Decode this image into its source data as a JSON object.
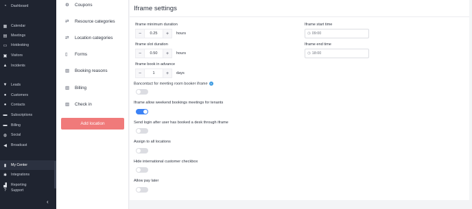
{
  "sidebar": {
    "items": [
      {
        "icon": "dashboard-icon",
        "glyph": "◔",
        "label": "Dashboard"
      },
      {
        "icon": "calendar-icon",
        "glyph": "▦",
        "label": "Calendar"
      },
      {
        "icon": "meetings-icon",
        "glyph": "▤",
        "label": "Meetings"
      },
      {
        "icon": "hotdesking-icon",
        "glyph": "▭",
        "label": "Hotdesking"
      },
      {
        "icon": "visitors-icon",
        "glyph": "▣",
        "label": "Visitors"
      },
      {
        "icon": "incidents-icon",
        "glyph": "▲",
        "label": "Incidents"
      },
      {
        "icon": "leads-icon",
        "glyph": "▼",
        "label": "Leads"
      },
      {
        "icon": "customers-icon",
        "glyph": "●",
        "label": "Customers"
      },
      {
        "icon": "contacts-icon",
        "glyph": "●",
        "label": "Contacts"
      },
      {
        "icon": "subscriptions-icon",
        "glyph": "▬",
        "label": "Subscriptions"
      },
      {
        "icon": "billing-icon",
        "glyph": "▬",
        "label": "Billing"
      },
      {
        "icon": "social-icon",
        "glyph": "◍",
        "label": "Social"
      },
      {
        "icon": "broadcast-icon",
        "glyph": "◀",
        "label": "Broadcast"
      },
      {
        "icon": "my-center-icon",
        "glyph": "▮",
        "label": "My Center"
      },
      {
        "icon": "integrations-icon",
        "glyph": "✱",
        "label": "Integrations"
      },
      {
        "icon": "reporting-icon",
        "glyph": "▟",
        "label": "Reporting"
      },
      {
        "icon": "support-icon",
        "glyph": "?",
        "label": "Support"
      }
    ],
    "collapse": "‹"
  },
  "menu": {
    "items": [
      {
        "icon": "coupons-icon",
        "glyph": "⚙",
        "label": "Coupons"
      },
      {
        "icon": "resource-categories-icon",
        "glyph": "⇄",
        "label": "Resource categories"
      },
      {
        "icon": "location-categories-icon",
        "glyph": "⇄",
        "label": "Location categories"
      },
      {
        "icon": "forms-icon",
        "glyph": "▯",
        "label": "Forms"
      },
      {
        "icon": "booking-reasons-icon",
        "glyph": "▥",
        "label": "Booking reasons"
      },
      {
        "icon": "billing-settings-icon",
        "glyph": "▥",
        "label": "Billing"
      },
      {
        "icon": "check-in-icon",
        "glyph": "▥",
        "label": "Check in"
      }
    ],
    "add_location": "Add location"
  },
  "iframe_settings": {
    "title": "Iframe settings",
    "min_duration": {
      "label": "Iframe minimum duration",
      "value": "0.25",
      "unit": "hours"
    },
    "slot_duration": {
      "label": "Iframe slot duration",
      "value": "0.50",
      "unit": "hours"
    },
    "book_in_advance": {
      "label": "Iframe book in advance",
      "value": "1",
      "unit": "days"
    },
    "start_time": {
      "label": "Iframe start time",
      "value": "09:00"
    },
    "end_time": {
      "label": "Iframe end time",
      "value": "18:00"
    },
    "toggles": [
      {
        "label": "Bancontact for meeting room booker iframe",
        "on": false,
        "help": true
      },
      {
        "label": "Iframe allow weekend bookings meetings for tenants",
        "on": true,
        "help": false
      },
      {
        "label": "Send login after user has booked a desk through iframe",
        "on": false,
        "help": false
      },
      {
        "label": "Assign to all locations",
        "on": false,
        "help": false
      },
      {
        "label": "Hide international customer checkbox",
        "on": false,
        "help": false
      },
      {
        "label": "Allow pay later",
        "on": false,
        "help": false
      }
    ],
    "minus": "−",
    "plus": "+",
    "help_glyph": "?",
    "clock_glyph": "◷"
  }
}
